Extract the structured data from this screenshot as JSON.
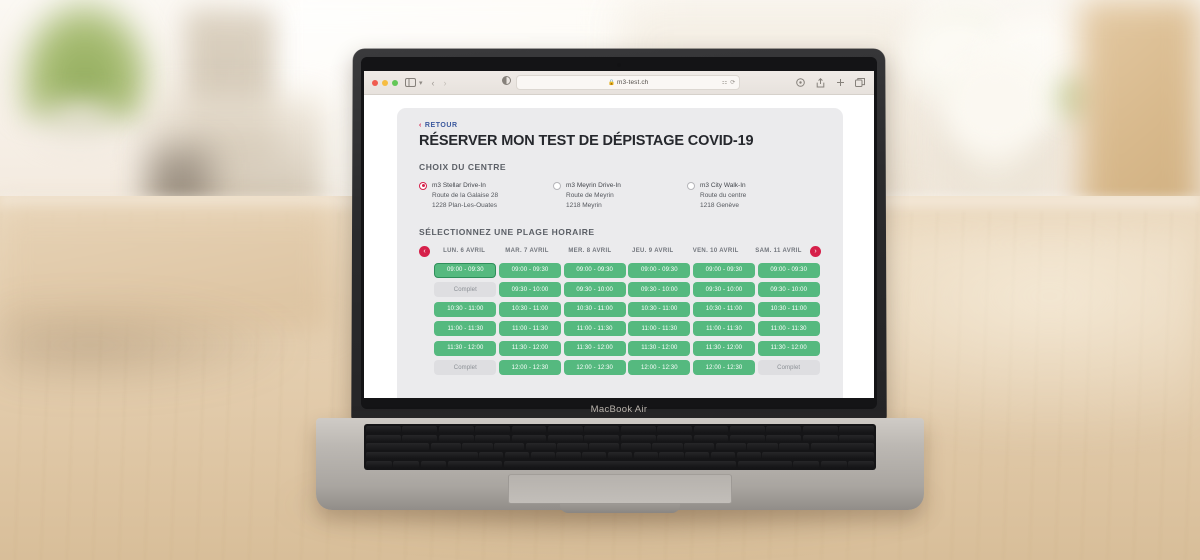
{
  "scene": {
    "device_label": "MacBook Air"
  },
  "browser": {
    "window_controls": [
      "close",
      "minimize",
      "zoom"
    ],
    "sidebar_icon": "sidebar-icon",
    "back_icon": "chevron-left-icon",
    "forward_icon": "chevron-right-icon",
    "reader_icon": "reader-mode-icon",
    "url": "m3-test.ch",
    "lock_icon": "lock-icon",
    "page_settings_icon": "page-settings-icon",
    "reload_icon": "reload-icon",
    "toolbar_right": [
      "privacy-report-icon",
      "share-icon",
      "new-tab-icon",
      "tab-overview-icon"
    ]
  },
  "page": {
    "back_link": "RETOUR",
    "back_chevron": "chevron-left-icon",
    "title": "RÉSERVER MON TEST DE DÉPISTAGE COVID-19",
    "centre_heading": "CHOIX DU CENTRE",
    "centres": [
      {
        "name": "m3 Stellar Drive-In",
        "street": "Route de la Galaise 28",
        "city": "1228 Plan-Les-Ouates",
        "selected": true
      },
      {
        "name": "m3 Meyrin Drive-In",
        "street": "Route de Meyrin",
        "city": "1218 Meyrin",
        "selected": false
      },
      {
        "name": "m3 City Walk-In",
        "street": "Route du centre",
        "city": "1218 Genève",
        "selected": false
      }
    ],
    "slot_heading": "SÉLECTIONNEZ UNE PLAGE HORAIRE",
    "prev_arrow": "arrow-left-icon",
    "next_arrow": "arrow-right-icon",
    "full_label": "Complet",
    "days": [
      {
        "label": "LUN. 6 AVRIL",
        "slots": [
          "09:00 - 09:30",
          "Complet",
          "10:30 - 11:00",
          "11:00 - 11:30",
          "11:30 - 12:00",
          "Complet"
        ]
      },
      {
        "label": "MAR. 7 AVRIL",
        "slots": [
          "09:00 - 09:30",
          "09:30 - 10:00",
          "10:30 - 11:00",
          "11:00 - 11:30",
          "11:30 - 12:00",
          "12:00 - 12:30"
        ]
      },
      {
        "label": "MER. 8 AVRIL",
        "slots": [
          "09:00 - 09:30",
          "09:30 - 10:00",
          "10:30 - 11:00",
          "11:00 - 11:30",
          "11:30 - 12:00",
          "12:00 - 12:30"
        ]
      },
      {
        "label": "JEU. 9 AVRIL",
        "slots": [
          "09:00 - 09:30",
          "09:30 - 10:00",
          "10:30 - 11:00",
          "11:00 - 11:30",
          "11:30 - 12:00",
          "12:00 - 12:30"
        ]
      },
      {
        "label": "VEN. 10 AVRIL",
        "slots": [
          "09:00 - 09:30",
          "09:30 - 10:00",
          "10:30 - 11:00",
          "11:00 - 11:30",
          "11:30 - 12:00",
          "12:00 - 12:30"
        ]
      },
      {
        "label": "SAM. 11 AVRIL",
        "slots": [
          "09:00 - 09:30",
          "09:30 - 10:00",
          "10:30 - 11:00",
          "11:00 - 11:30",
          "11:30 - 12:00",
          "Complet"
        ]
      }
    ],
    "selected_slot": {
      "day": 0,
      "row": 0
    }
  },
  "colors": {
    "accent_red": "#d6204a",
    "link_blue": "#3d5a9e",
    "slot_green": "#55b97f",
    "slot_green_selected_border": "#2f8f5b",
    "slot_full_bg": "#dedee1",
    "card_bg": "#ebebed",
    "title_text": "#26282d"
  }
}
